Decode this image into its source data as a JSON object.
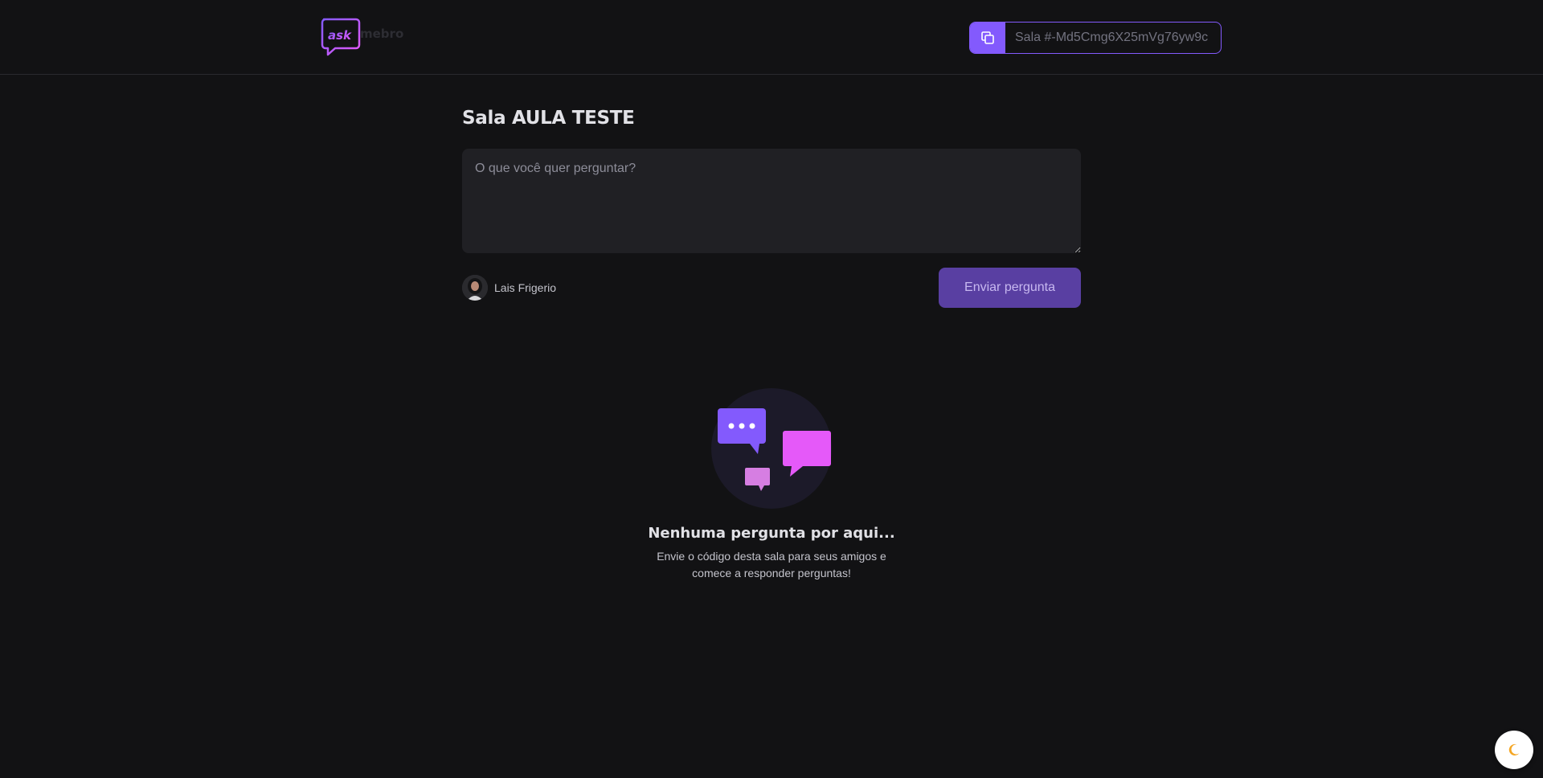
{
  "header": {
    "logo": {
      "text_main": "ask",
      "text_secondary": "mebro"
    },
    "room_code": {
      "label": "Sala #-Md5Cmg6X25mVg76yw9c"
    }
  },
  "room": {
    "title": "Sala AULA TESTE"
  },
  "question_form": {
    "placeholder": "O que você quer perguntar?",
    "user_name": "Lais Frigerio",
    "submit_label": "Enviar pergunta"
  },
  "empty_state": {
    "title": "Nenhuma pergunta por aqui...",
    "description": "Envie o código desta sala para seus amigos e comece a responder perguntas!"
  },
  "icons": {
    "copy": "copy-icon",
    "theme": "moon-icon"
  },
  "colors": {
    "background": "#121214",
    "accent": "#835afd",
    "button": "#593fa2",
    "pink": "#e559f9",
    "moon": "#f5a623"
  }
}
